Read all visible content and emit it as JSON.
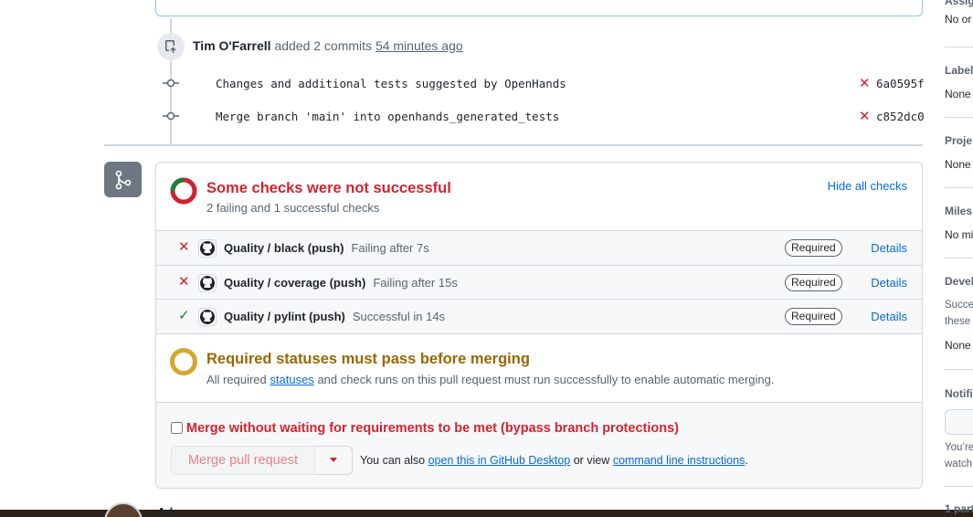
{
  "timeline": {
    "actor": "Tim O'Farrell",
    "action": "added 2 commits",
    "time": "54 minutes ago",
    "commits": [
      {
        "message": "Changes and additional tests suggested by OpenHands",
        "sha": "6a0595f",
        "status": "fail"
      },
      {
        "message": "Merge branch 'main' into openhands_generated_tests",
        "sha": "c852dc0",
        "status": "fail"
      }
    ]
  },
  "checks": {
    "title": "Some checks were not successful",
    "subtitle": "2 failing and 1 successful checks",
    "hide_label": "Hide all checks",
    "items": [
      {
        "name": "Quality / black (push)",
        "desc": "Failing after 7s",
        "status": "fail",
        "required": "Required",
        "details": "Details"
      },
      {
        "name": "Quality / coverage (push)",
        "desc": "Failing after 15s",
        "status": "fail",
        "required": "Required",
        "details": "Details"
      },
      {
        "name": "Quality / pylint (push)",
        "desc": "Successful in 14s",
        "status": "ok",
        "required": "Required",
        "details": "Details"
      }
    ]
  },
  "required": {
    "title": "Required statuses must pass before merging",
    "sub_before": "All required",
    "sub_link": "statuses",
    "sub_after": "and check runs on this pull request must run successfully to enable automatic merging."
  },
  "merge": {
    "bypass_label": "Merge without waiting for requirements to be met (bypass branch protections)",
    "button_label": "Merge pull request",
    "hint_before": "You can also",
    "hint_link1": "open this in GitHub Desktop",
    "hint_middle": "or view",
    "hint_link2": "command line instructions",
    "hint_end": "."
  },
  "next_comment": {
    "actor": "Ad"
  },
  "sidebar": {
    "assignees": {
      "head": "Assig",
      "value": "No or"
    },
    "labels": {
      "head": "Label",
      "value": "None"
    },
    "projects": {
      "head": "Proje",
      "value": "None"
    },
    "milestone": {
      "head": "Miles",
      "value": "No mi"
    },
    "development": {
      "head": "Devel",
      "line1": "Succe",
      "line2": "these",
      "value": "None"
    },
    "notifications": {
      "head": "Notifi",
      "line1": "You’re",
      "line2": "watch"
    },
    "participants": {
      "head": "1 part"
    }
  },
  "colors": {
    "fail": "#cf222e",
    "success": "#1a7f37",
    "warning": "#d4a72c",
    "link": "#0969da"
  }
}
